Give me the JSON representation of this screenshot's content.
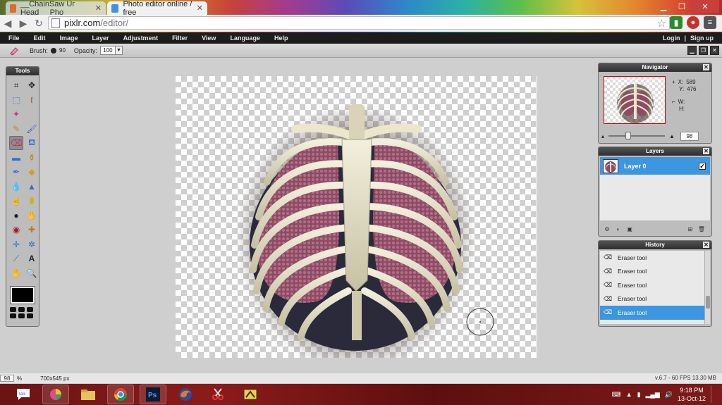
{
  "browser": {
    "tabs": [
      {
        "label": "__ChainSaw Ur Head__ Pho",
        "active": false
      },
      {
        "label": "Photo editor online / free",
        "active": true
      }
    ],
    "url_host": "pixlr.com",
    "url_path": "/editor/"
  },
  "menubar": {
    "items": [
      "File",
      "Edit",
      "Image",
      "Layer",
      "Adjustment",
      "Filter",
      "View",
      "Language",
      "Help"
    ],
    "login": "Login",
    "separator": "|",
    "signup": "Sign up"
  },
  "options": {
    "brush_label": "Brush:",
    "brush_size": "90",
    "opacity_label": "Opacity:",
    "opacity_value": "100"
  },
  "tools_panel": {
    "title": "Tools",
    "selected": "eraser-tool"
  },
  "navigator": {
    "title": "Navigator",
    "x_label": "X:",
    "x_value": "589",
    "y_label": "Y:",
    "y_value": "476",
    "w_label": "W:",
    "h_label": "H:",
    "zoom": "98"
  },
  "layers": {
    "title": "Layers",
    "items": [
      {
        "name": "Layer 0",
        "visible": true
      }
    ]
  },
  "history": {
    "title": "History",
    "items": [
      "Eraser tool",
      "Eraser tool",
      "Eraser tool",
      "Eraser tool",
      "Eraser tool"
    ],
    "selected_index": 4
  },
  "status": {
    "zoom": "98",
    "zoom_unit": "%",
    "dimensions": "700x545 px",
    "info": "v.6.7 - 60 FPS 13.30 MB"
  },
  "taskbar": {
    "apps": [
      "talk",
      "picasa",
      "explorer",
      "chrome",
      "photoshop",
      "firefox",
      "snipping-tool",
      "app"
    ],
    "time": "9:18 PM",
    "date": "13-Oct-12"
  },
  "colors": {
    "accent": "#3d96e0",
    "menubar": "#1d1d1d",
    "primary_color": "#000000"
  }
}
